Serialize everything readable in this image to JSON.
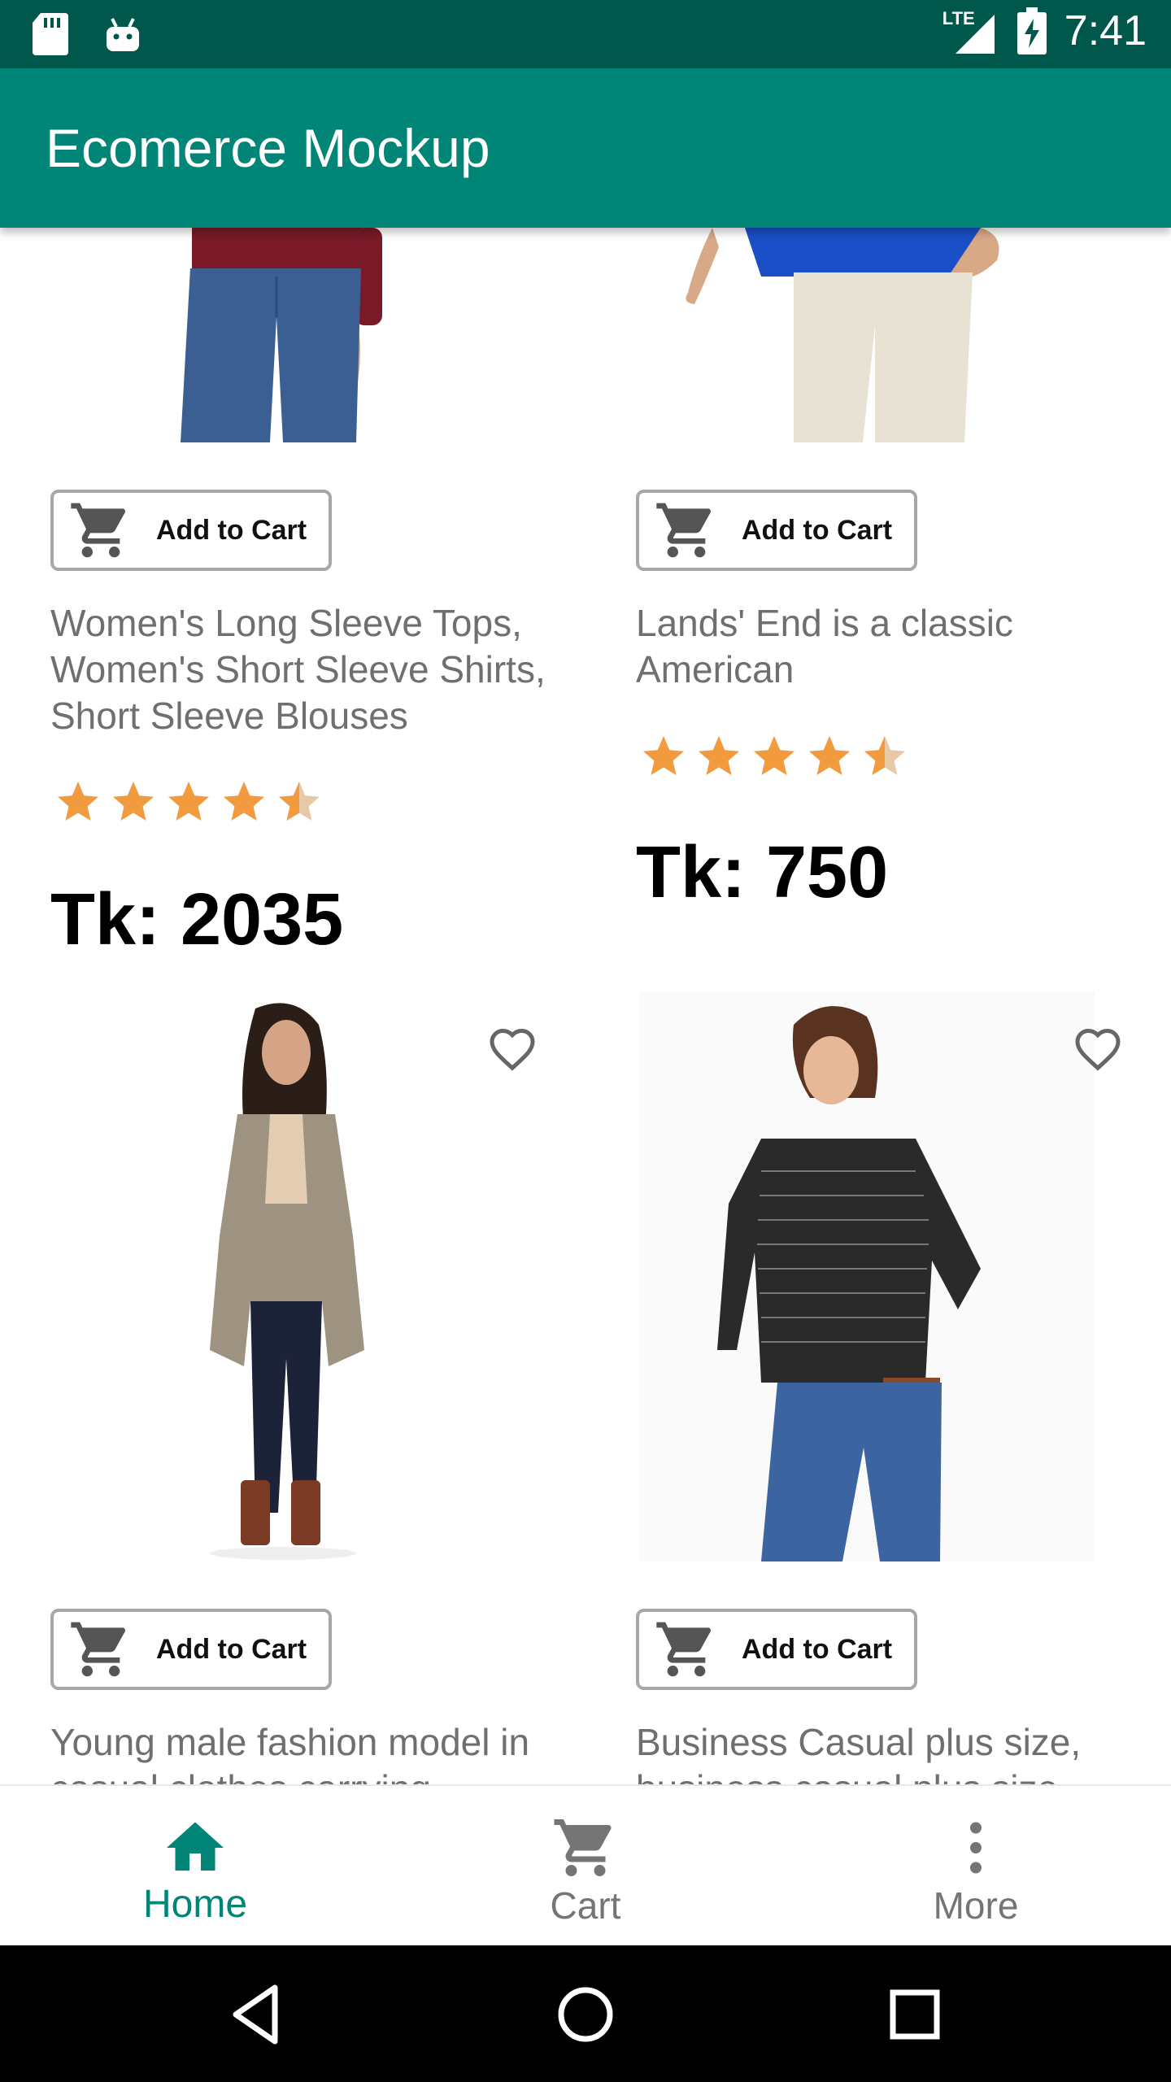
{
  "status_bar": {
    "time": "7:41",
    "network": "LTE"
  },
  "app_bar": {
    "title": "Ecomerce Mockup"
  },
  "products": [
    {
      "add_label": "Add to Cart",
      "description": "Women's Long Sleeve Tops, Women's Short Sleeve Shirts, Short Sleeve Blouses",
      "rating": 4.5,
      "price": "Tk: 2035",
      "image_colors": {
        "top": "#7a1a28",
        "pants": "#3b5f92"
      }
    },
    {
      "add_label": "Add to Cart",
      "description": "Lands' End is a classic American",
      "rating": 4.5,
      "price": "Tk: 750",
      "image_colors": {
        "top": "#1a4fc8",
        "pants": "#e8e2d4"
      }
    },
    {
      "add_label": "Add to Cart",
      "description": "Young male fashion model in casual clothes carrying",
      "image_colors": {
        "blazer": "#9e9280",
        "pants": "#1c2238",
        "boots": "#7a3a24"
      }
    },
    {
      "add_label": "Add to Cart",
      "description": "Business Casual plus size, business casual plus size",
      "image_colors": {
        "top": "#2a2a2a",
        "pants": "#3c64a0"
      }
    }
  ],
  "bottom_nav": {
    "items": [
      {
        "label": "Home",
        "icon": "home-icon",
        "active": true
      },
      {
        "label": "Cart",
        "icon": "cart-icon",
        "active": false
      },
      {
        "label": "More",
        "icon": "more-vertical-icon",
        "active": false
      }
    ]
  },
  "colors": {
    "primary": "#008577",
    "primary_dark": "#00574B",
    "star": "#F29A3E",
    "text_secondary": "#6f6f6f"
  }
}
